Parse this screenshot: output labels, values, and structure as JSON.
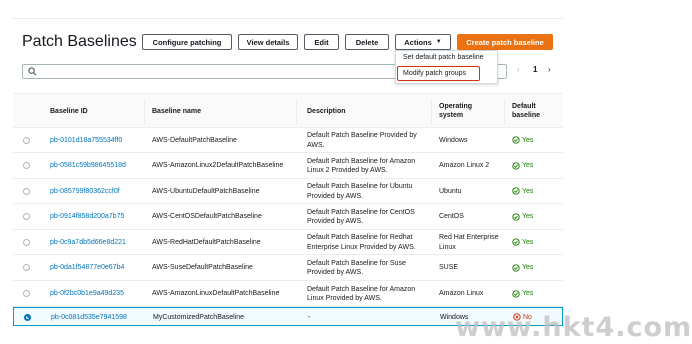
{
  "page": {
    "title": "Patch Baselines"
  },
  "toolbar": {
    "configure_label": "Configure patching",
    "view_details_label": "View details",
    "edit_label": "Edit",
    "delete_label": "Delete",
    "actions_label": "Actions",
    "create_label": "Create patch baseline"
  },
  "actions_menu": {
    "items": [
      "Set default patch baseline",
      "Modify patch groups"
    ]
  },
  "search": {
    "placeholder": ""
  },
  "pagination": {
    "current_page": "1",
    "prev_icon": "chevron-left-icon",
    "next_icon": "chevron-right-icon"
  },
  "table": {
    "headers": {
      "baseline_id": "Baseline ID",
      "baseline_name": "Baseline name",
      "description": "Description",
      "os": "Operating system",
      "default": "Default baseline"
    },
    "rows": [
      {
        "id": "pb-0101d18a755534ff0",
        "name": "AWS-DefaultPatchBaseline",
        "description": "Default Patch Baseline Provided by AWS.",
        "os": "Windows",
        "default": "Yes"
      },
      {
        "id": "pb-0581c59b98645518d",
        "name": "AWS-AmazonLinux2DefaultPatchBaseline",
        "description": "Default Patch Baseline for Amazon Linux 2 Provided by AWS.",
        "os": "Amazon Linux 2",
        "default": "Yes"
      },
      {
        "id": "pb-085799f80362ccf0f",
        "name": "AWS-UbuntuDefaultPatchBaseline",
        "description": "Default Patch Baseline for Ubuntu Provided by AWS.",
        "os": "Ubuntu",
        "default": "Yes"
      },
      {
        "id": "pb-0914f858d200a7b75",
        "name": "AWS-CentOSDefaultPatchBaseline",
        "description": "Default Patch Baseline for CentOS Provided by AWS.",
        "os": "CentOS",
        "default": "Yes"
      },
      {
        "id": "pb-0c9a7db5d66e8d221",
        "name": "AWS-RedHatDefaultPatchBaseline",
        "description": "Default Patch Baseline for Redhat Enterprise Linux Provided by AWS.",
        "os": "Red Hat Enterprise Linux",
        "default": "Yes"
      },
      {
        "id": "pb-0da1f54877e0e67b4",
        "name": "AWS-SuseDefaultPatchBaseline",
        "description": "Default Patch Baseline for Suse Provided by AWS.",
        "os": "SUSE",
        "default": "Yes"
      },
      {
        "id": "pb-0f2bc0b1e9a49d235",
        "name": "AWS-AmazonLinuxDefaultPatchBaseline",
        "description": "Default Patch Baseline for Amazon Linux Provided by AWS.",
        "os": "Amazon Linux",
        "default": "Yes"
      },
      {
        "id": "pb-0c081d535e7941598",
        "name": "MyCustomizedPatchBaseline",
        "description": "-",
        "os": "Windows",
        "default": "No"
      }
    ]
  },
  "watermark": "www.hkt4.com",
  "colors": {
    "primary": "#ec7211",
    "link": "#0073bb",
    "yes": "#1d8102",
    "no": "#d13212"
  }
}
